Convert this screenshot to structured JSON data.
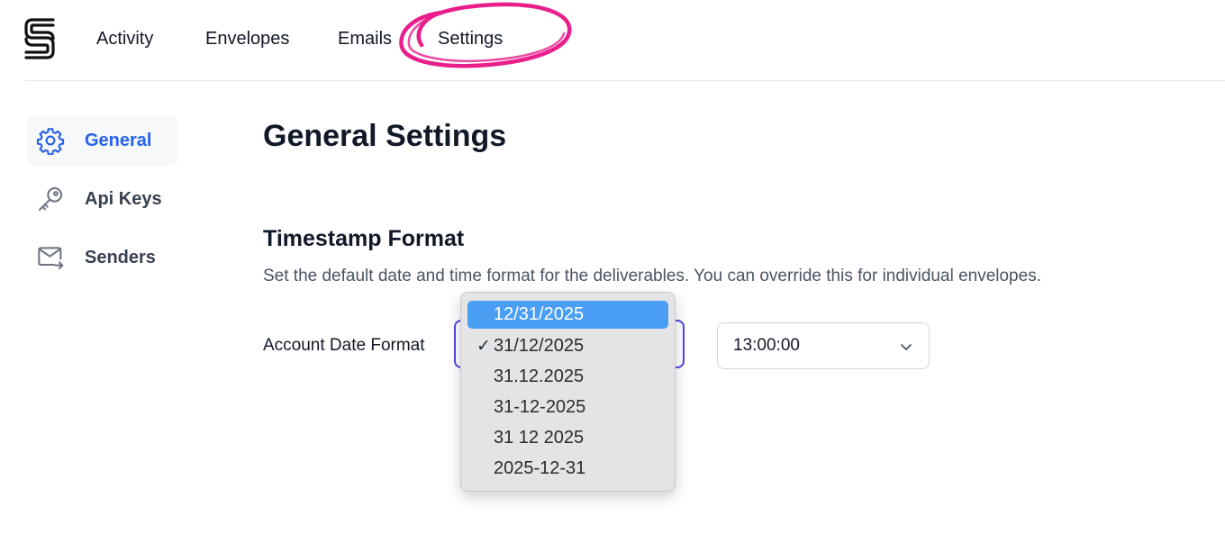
{
  "nav": {
    "items": [
      {
        "label": "Activity"
      },
      {
        "label": "Envelopes"
      },
      {
        "label": "Emails"
      },
      {
        "label": "Settings"
      }
    ],
    "highlight_color": "#e91e8c"
  },
  "sidebar": {
    "items": [
      {
        "label": "General",
        "icon": "gear-icon",
        "active": true
      },
      {
        "label": "Api Keys",
        "icon": "key-icon",
        "active": false
      },
      {
        "label": "Senders",
        "icon": "envelope-arrow-icon",
        "active": false
      }
    ],
    "active_color": "#2563eb"
  },
  "main": {
    "title": "General Settings",
    "section": {
      "title": "Timestamp Format",
      "description": "Set the default date and time format for the deliverables. You can override this for individual envelopes."
    },
    "date_format": {
      "label": "Account Date Format",
      "selected": "31/12/2025",
      "options": [
        {
          "label": "12/31/2025",
          "checked": false,
          "highlighted": true
        },
        {
          "label": "31/12/2025",
          "checked": true,
          "highlighted": false
        },
        {
          "label": "31.12.2025",
          "checked": false,
          "highlighted": false
        },
        {
          "label": "31-12-2025",
          "checked": false,
          "highlighted": false
        },
        {
          "label": "31 12 2025",
          "checked": false,
          "highlighted": false
        },
        {
          "label": "2025-12-31",
          "checked": false,
          "highlighted": false
        }
      ],
      "check_mark": "✓"
    },
    "time_format": {
      "value": "13:00:00",
      "chevron_icon": "chevron-down-icon"
    }
  },
  "colors": {
    "focus_ring": "#4f46e5",
    "dropdown_highlight": "#4a9ff5"
  }
}
